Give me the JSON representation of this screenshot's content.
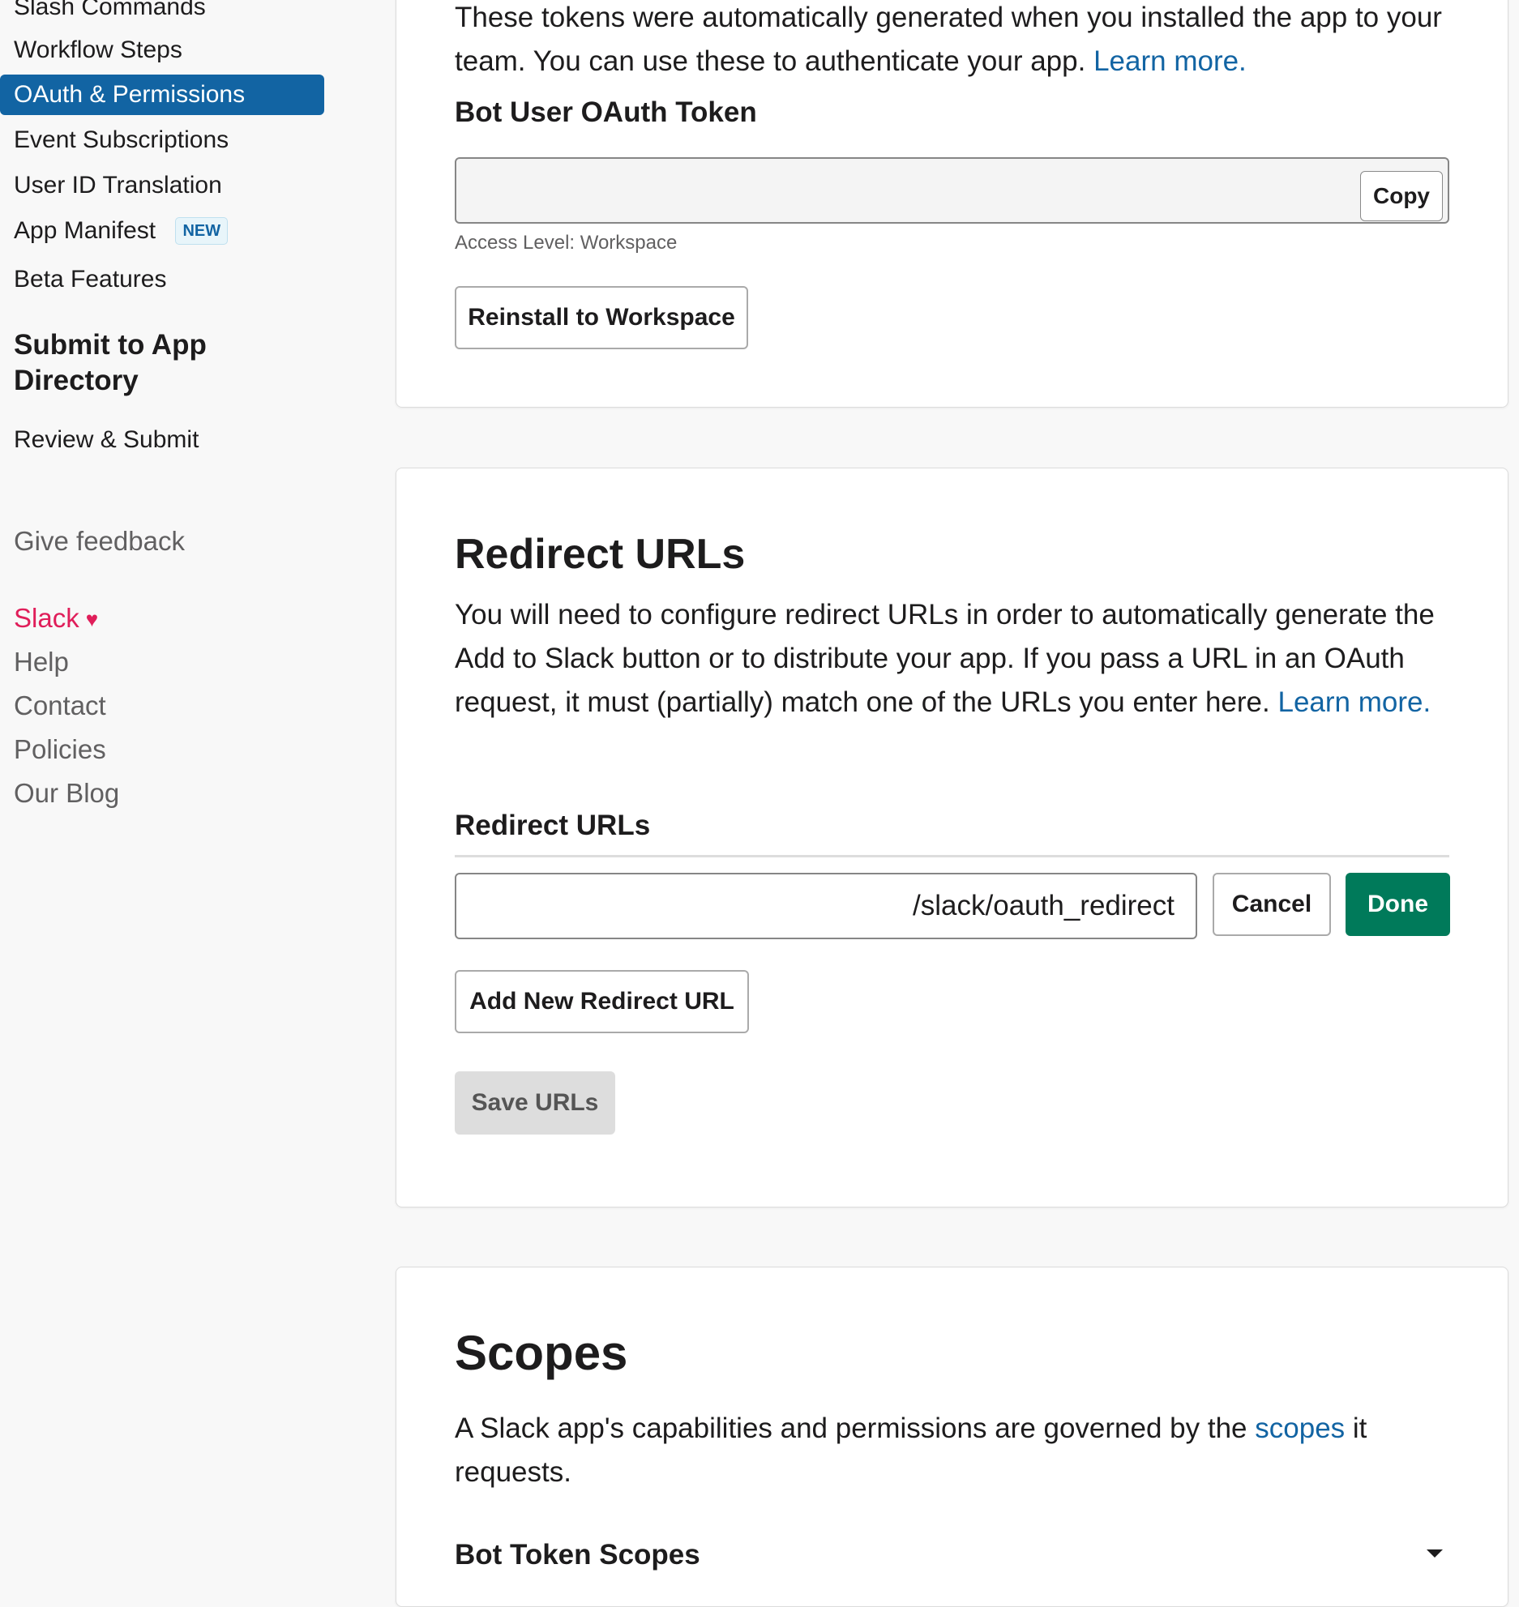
{
  "sidebar": {
    "items": [
      {
        "label": "Slash Commands",
        "active": false
      },
      {
        "label": "Workflow Steps",
        "active": false
      },
      {
        "label": "OAuth & Permissions",
        "active": true
      },
      {
        "label": "Event Subscriptions",
        "active": false
      },
      {
        "label": "User ID Translation",
        "active": false
      },
      {
        "label": "App Manifest",
        "active": false,
        "badge": "NEW"
      },
      {
        "label": "Beta Features",
        "active": false
      }
    ],
    "submit_heading": "Submit to App Directory",
    "review_submit": "Review & Submit",
    "give_feedback": "Give feedback",
    "footer": {
      "slack": "Slack",
      "heart_icon": "heart-icon",
      "help": "Help",
      "contact": "Contact",
      "policies": "Policies",
      "blog": "Our Blog"
    }
  },
  "tokens": {
    "intro": "These tokens were automatically generated when you installed the app to your team. You can use these to authenticate your app.",
    "learn_more": "Learn more.",
    "bot_token_label": "Bot User OAuth Token",
    "token_value": "",
    "copy_label": "Copy",
    "access_level": "Access Level: Workspace",
    "reinstall_label": "Reinstall to Workspace"
  },
  "redirect": {
    "title": "Redirect URLs",
    "description": "You will need to configure redirect URLs in order to automatically generate the Add to Slack button or to distribute your app. If you pass a URL in an OAuth request, it must (partially) match one of the URLs you enter here.",
    "learn_more": "Learn more.",
    "field_label": "Redirect URLs",
    "url_value": "/slack/oauth_redirect",
    "cancel_label": "Cancel",
    "done_label": "Done",
    "add_new_label": "Add New Redirect URL",
    "save_label": "Save URLs"
  },
  "scopes": {
    "title": "Scopes",
    "description_before": "A Slack app's capabilities and permissions are governed by the",
    "scopes_link": "scopes",
    "description_after": "it requests.",
    "bot_scopes_label": "Bot Token Scopes"
  },
  "colors": {
    "active_nav": "#1264a3",
    "link": "#1264a3",
    "primary_button": "#007a5a",
    "slack_red": "#e01e5a"
  }
}
